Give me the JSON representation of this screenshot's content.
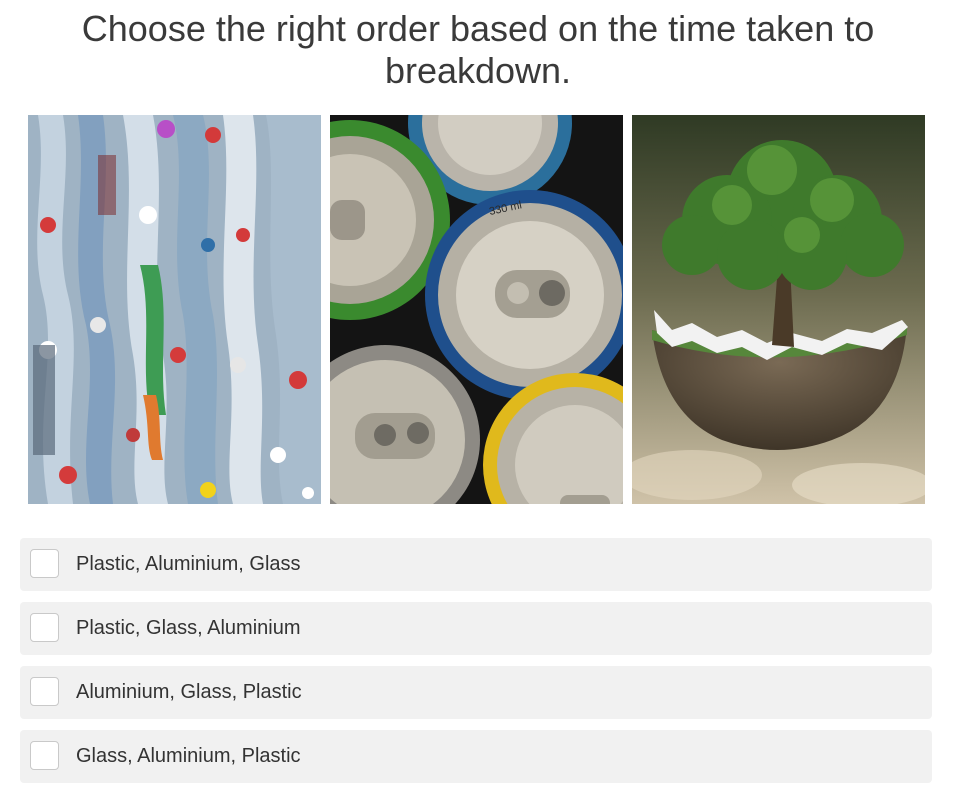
{
  "question": {
    "text": "Choose the right order based on the time taken to breakdown."
  },
  "images": [
    {
      "name": "plastic-bottles-image",
      "content": "plastic-bottles"
    },
    {
      "name": "aluminium-cans-image",
      "content": "aluminium-cans",
      "label": "330 ml"
    },
    {
      "name": "tree-globe-image",
      "content": "tree-on-earth-sphere"
    }
  ],
  "options": [
    {
      "label": "Plastic, Aluminium, Glass",
      "checked": false
    },
    {
      "label": "Plastic, Glass, Aluminium",
      "checked": false
    },
    {
      "label": "Aluminium, Glass, Plastic",
      "checked": false
    },
    {
      "label": "Glass, Aluminium, Plastic",
      "checked": false
    }
  ],
  "colors": {
    "option_background": "#f1f1f1",
    "checkbox_border": "#c9c9c9",
    "question_text": "#3a3a3a"
  }
}
